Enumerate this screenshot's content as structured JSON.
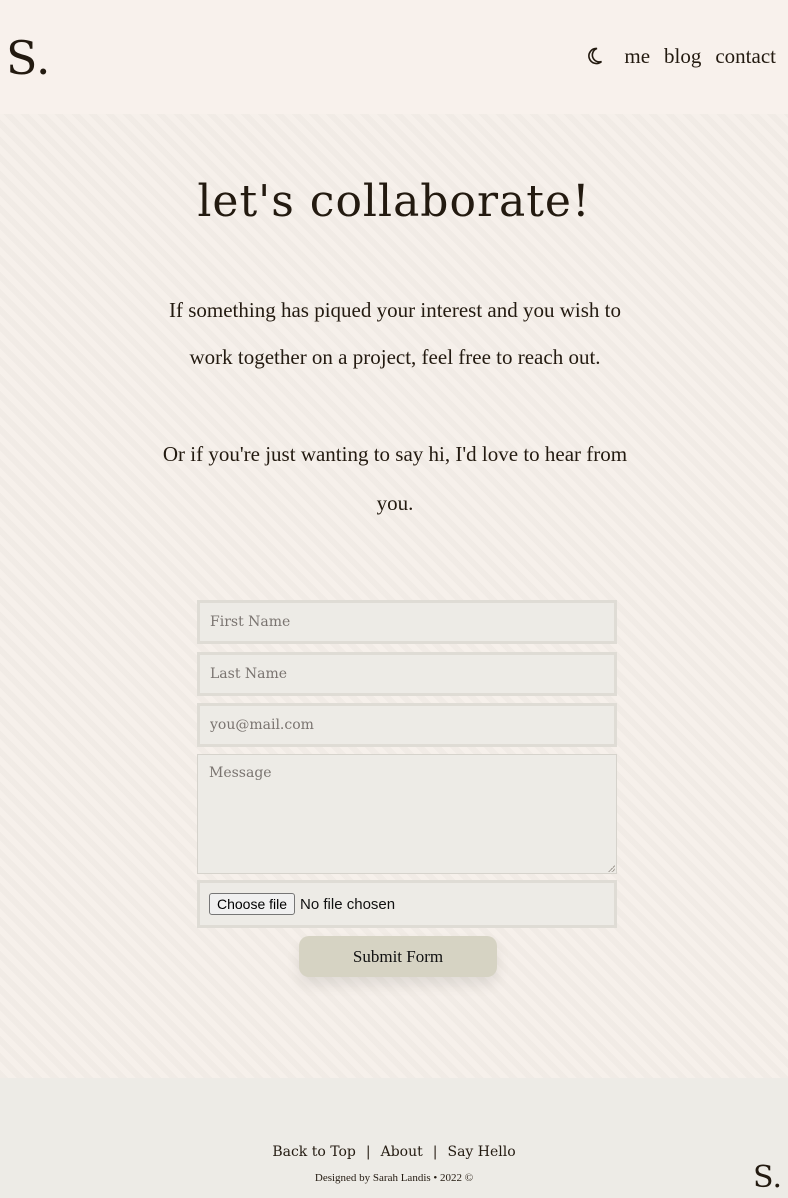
{
  "header": {
    "logo": "S.",
    "theme_toggle_icon": "moon-icon",
    "nav": [
      {
        "label": "me"
      },
      {
        "label": "blog"
      },
      {
        "label": "contact"
      }
    ]
  },
  "main": {
    "title": "let's collaborate!",
    "intro_paragraph": "If something has piqued your interest and you wish to work together on a project, feel free to reach out.",
    "intro_paragraph_2": "Or if you're just wanting to say hi, I'd love to hear from you."
  },
  "form": {
    "first_name": {
      "placeholder": "First Name",
      "value": ""
    },
    "last_name": {
      "placeholder": "Last Name",
      "value": ""
    },
    "email": {
      "placeholder": "you@mail.com",
      "value": ""
    },
    "message": {
      "placeholder": "Message",
      "value": ""
    },
    "file": {
      "button_label": "Choose file",
      "status": "No file chosen"
    },
    "submit_label": "Submit Form"
  },
  "footer": {
    "links": [
      {
        "label": "Back to Top"
      },
      {
        "label": "About"
      },
      {
        "label": "Say Hello"
      }
    ],
    "separator": "|",
    "credit": "Designed by Sarah Landis • 2022 ©",
    "logo": "S."
  },
  "colors": {
    "background": "#f8f1ec",
    "text": "#231a10",
    "input_background": "#edebe6",
    "submit_background": "#d6d3c3",
    "footer_background": "#edebe6"
  }
}
